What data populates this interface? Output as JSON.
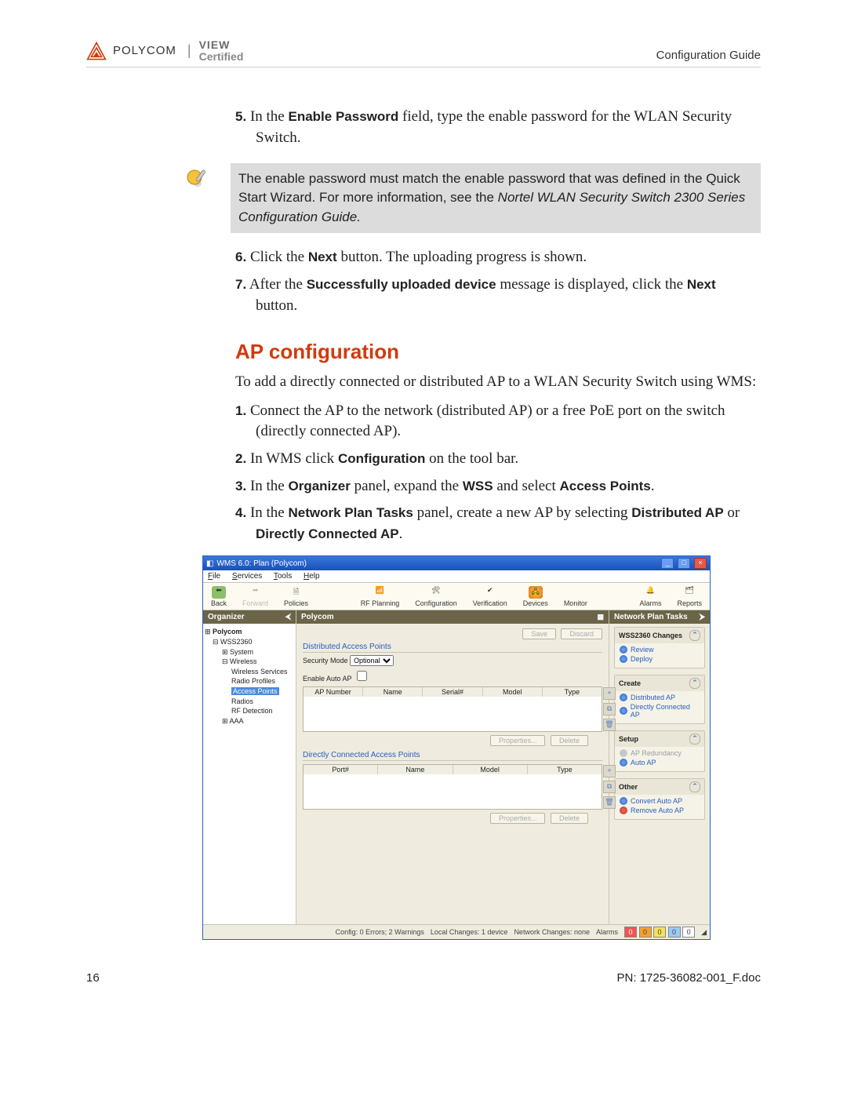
{
  "header": {
    "brand": "POLYCOM",
    "sub1": "VIEW",
    "sub2": "Certified",
    "right": "Configuration Guide"
  },
  "steps_a": [
    {
      "num": "5.",
      "pre": "In the ",
      "bold": "Enable Password",
      "post": " field, type the enable password for the WLAN Security Switch."
    }
  ],
  "note": {
    "line1": "The enable password must match the enable password that was defined in the Quick Start Wizard. For more information, see the ",
    "italic": "Nortel WLAN Security Switch 2300 Series Configuration Guide."
  },
  "steps_b": [
    {
      "num": "6.",
      "pre": "Click the ",
      "bold": "Next",
      "post": " button. The uploading progress is shown."
    },
    {
      "num": "7.",
      "pre": "After the ",
      "bold": "Successfully uploaded device",
      "post": " message is displayed, click the ",
      "bold2": "Next",
      "post2": " button."
    }
  ],
  "section_heading": "AP configuration",
  "intro": "To add a directly connected or distributed AP to a WLAN Security Switch using WMS:",
  "steps_c": [
    {
      "num": "1.",
      "text": "Connect the AP to the network (distributed AP) or a free PoE port on the switch (directly connected AP)."
    },
    {
      "num": "2.",
      "pre": "In WMS click ",
      "bold": "Configuration",
      "post": " on the tool bar."
    },
    {
      "num": "3.",
      "pre": "In the ",
      "bold": "Organizer",
      "post": " panel, expand the ",
      "bold2": "WSS",
      "post2": " and select ",
      "bold3": "Access Points",
      "post3": "."
    },
    {
      "num": "4.",
      "pre": "In the ",
      "bold": "Network Plan Tasks",
      "post": " panel, create a new AP by selecting ",
      "bold2": "Distributed AP",
      "post2": " or ",
      "bold3": "Directly Connected AP",
      "post3": "."
    }
  ],
  "window": {
    "title": "WMS 6.0: Plan (Polycom)",
    "menu": [
      "File",
      "Services",
      "Tools",
      "Help"
    ],
    "toolbar": [
      {
        "label": "Back"
      },
      {
        "label": "Forward"
      },
      {
        "label": "Policies"
      },
      {
        "label": "RF Planning"
      },
      {
        "label": "Configuration"
      },
      {
        "label": "Verification"
      },
      {
        "label": "Devices"
      },
      {
        "label": "Monitor"
      },
      {
        "label": "Alarms"
      },
      {
        "label": "Reports"
      }
    ],
    "organizer": {
      "title": "Organizer",
      "tree": [
        {
          "cls": "n0 row",
          "label": "Polycom"
        },
        {
          "cls": "row indent1",
          "label": "⊟ WSS2360"
        },
        {
          "cls": "row indent2",
          "label": "⊞ System"
        },
        {
          "cls": "row indent2",
          "label": "⊟ Wireless"
        },
        {
          "cls": "row indent3",
          "label": "Wireless Services"
        },
        {
          "cls": "row indent3",
          "label": "Radio Profiles"
        },
        {
          "cls": "row indent3",
          "sel": true,
          "label": "Access Points"
        },
        {
          "cls": "row indent3",
          "label": "Radios"
        },
        {
          "cls": "row indent3",
          "label": "RF Detection"
        },
        {
          "cls": "row indent2",
          "label": "⊞ AAA"
        }
      ]
    },
    "center": {
      "title": "Polycom",
      "save": "Save",
      "discard": "Discard",
      "group1": "Distributed Access Points",
      "sec_mode_label": "Security Mode",
      "sec_mode_value": "Optional",
      "auto_ap_label": "Enable Auto AP",
      "cols1": [
        "AP Number",
        "Name",
        "Serial#",
        "Model",
        "Type"
      ],
      "group2": "Directly Connected Access Points",
      "cols2": [
        "Port#",
        "Name",
        "Model",
        "Type"
      ],
      "btn_props": "Properties...",
      "btn_del": "Delete"
    },
    "tasks": {
      "title": "Network Plan Tasks",
      "groups": [
        {
          "head": "WSS2360 Changes",
          "items": [
            {
              "t": "Review",
              "c": "arrow"
            },
            {
              "t": "Deploy",
              "c": "arrow"
            }
          ]
        },
        {
          "head": "Create",
          "items": [
            {
              "t": "Distributed AP",
              "c": "arrow"
            },
            {
              "t": "Directly Connected AP",
              "c": "arrow"
            }
          ]
        },
        {
          "head": "Setup",
          "items": [
            {
              "t": "AP Redundancy",
              "c": "muted"
            },
            {
              "t": "Auto AP",
              "c": "arrow"
            }
          ]
        },
        {
          "head": "Other",
          "items": [
            {
              "t": "Convert Auto AP",
              "c": "arrow"
            },
            {
              "t": "Remove Auto AP",
              "c": "red"
            }
          ]
        }
      ]
    },
    "status": {
      "config": "Config: 0 Errors; 2 Warnings",
      "local": "Local Changes: 1 device",
      "network": "Network Changes: none",
      "alarms_label": "Alarms",
      "alarms": [
        "0",
        "0",
        "0",
        "0",
        "0"
      ]
    }
  },
  "footer": {
    "page": "16",
    "pn": "PN: 1725-36082-001_F.doc"
  }
}
